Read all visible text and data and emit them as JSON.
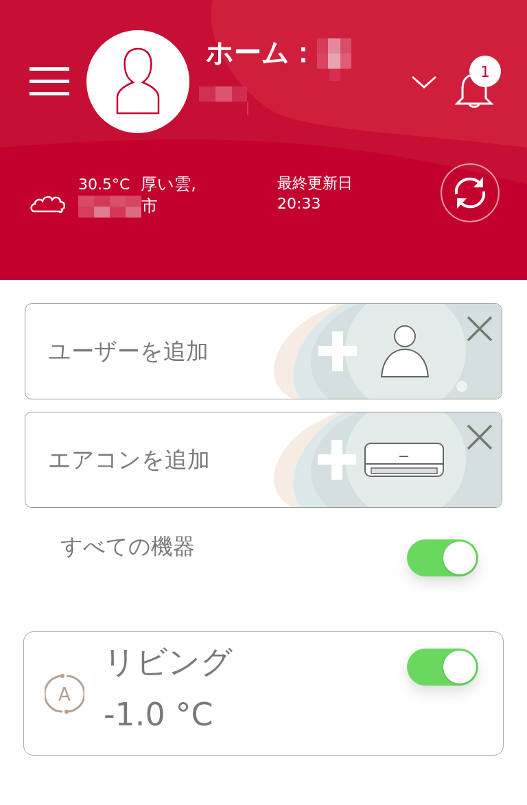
{
  "header": {
    "title": "ホーム：",
    "notification_count": "1",
    "weather": {
      "temperature": "30.5°C",
      "condition": "厚い雲,",
      "city_suffix": "市"
    },
    "last_updated": {
      "label": "最終更新日",
      "time": "20:33"
    }
  },
  "add_cards": [
    {
      "kind": "user",
      "label": "ユーザーを追加"
    },
    {
      "kind": "aircon",
      "label": "エアコンを追加"
    }
  ],
  "all_devices": {
    "label": "すべての機器",
    "on": true
  },
  "rooms": [
    {
      "name": "リビング",
      "mode": "A",
      "temperature": "-1.0 °C",
      "on": true
    }
  ]
}
